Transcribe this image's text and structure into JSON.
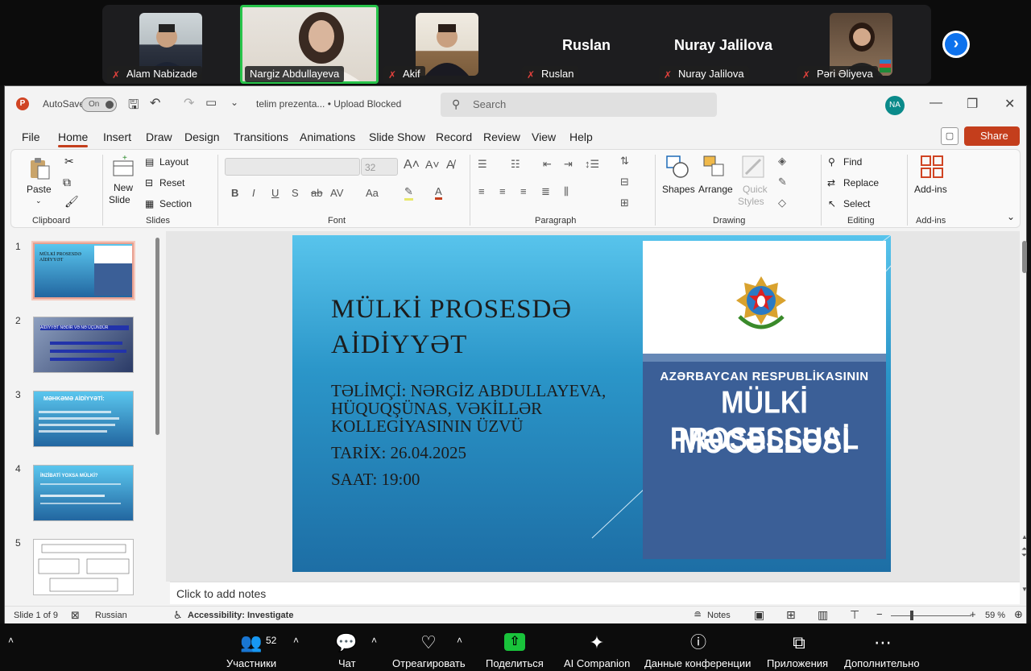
{
  "participants": [
    {
      "name": "Alam Nabizade",
      "muted": true,
      "has_video": true
    },
    {
      "name": "Nargiz Abdullayeva",
      "muted": false,
      "has_video": true,
      "active_speaker": true
    },
    {
      "name": "Akif",
      "muted": true,
      "has_video": true
    },
    {
      "name": "Ruslan",
      "muted": true,
      "has_video": false,
      "display_name": "Ruslan"
    },
    {
      "name": "Nuray Jalilova",
      "muted": true,
      "has_video": false,
      "display_name": "Nuray Jalilova"
    },
    {
      "name": "Pəri Əliyeva",
      "muted": true,
      "has_video": true
    }
  ],
  "ppt": {
    "autosave_label": "AutoSave",
    "autosave_state": "On",
    "filename": "telim prezenta... • Upload Blocked",
    "search_placeholder": "Search",
    "user_initials": "NA",
    "share_label": "Share",
    "menu": [
      "File",
      "Home",
      "Insert",
      "Draw",
      "Design",
      "Transitions",
      "Animations",
      "Slide Show",
      "Record",
      "Review",
      "View",
      "Help"
    ],
    "active_tab": "Home",
    "ribbon": {
      "clipboard": {
        "paste": "Paste",
        "label": "Clipboard"
      },
      "slides": {
        "new_slide_1": "New",
        "new_slide_2": "Slide",
        "layout": "Layout",
        "reset": "Reset",
        "section": "Section",
        "label": "Slides"
      },
      "font": {
        "size": "32",
        "label": "Font"
      },
      "paragraph": {
        "label": "Paragraph"
      },
      "drawing": {
        "shapes": "Shapes",
        "arrange": "Arrange",
        "quick_styles_1": "Quick",
        "quick_styles_2": "Styles",
        "label": "Drawing"
      },
      "editing": {
        "find": "Find",
        "replace": "Replace",
        "select": "Select",
        "label": "Editing"
      },
      "addins": {
        "button": "Add-ins",
        "label": "Add-ins"
      }
    },
    "thumbnails": [
      {
        "num": "1",
        "title": "MÜLKİ PROSESDƏ AİDİYYƏT"
      },
      {
        "num": "2",
        "title": "AİDİYYƏT NƏDİR VƏ NƏ ÜÇÜNDÜR"
      },
      {
        "num": "3",
        "title": "MƏHKƏMƏ AİDİYYƏTİ:"
      },
      {
        "num": "4",
        "title": "İNZİBATİ YOXSA MÜLKİ?"
      },
      {
        "num": "5",
        "title": ""
      }
    ],
    "slide": {
      "title": "MÜLKİ PROSESDƏ AİDİYYƏT",
      "trainer_line1": "TƏLİMÇİ: NƏRGİZ ABDULLAYEVA,",
      "trainer_line2": "HÜQUQŞÜNAS, VƏKİLLƏR",
      "trainer_line3": "KOLLEGİYASININ ÜZVÜ",
      "date": "TARİX: 26.04.2025",
      "time": "SAAT: 19:00",
      "book_subtitle": "AZƏRBAYCAN RESPUBLİKASININ",
      "book_title1": "MÜLKİ PROSESSUAL",
      "book_title2": "MƏCƏLLƏSİ"
    },
    "notes_placeholder": "Click to add notes",
    "status": {
      "slide_info": "Slide 1 of 9",
      "language": "Russian",
      "accessibility": "Accessibility: Investigate",
      "notes": "Notes",
      "zoom": "59 %"
    }
  },
  "zoom_toolbar": {
    "participants_label": "Участники",
    "participants_count": "52",
    "chat_label": "Чат",
    "react_label": "Отреагировать",
    "share_label": "Поделиться",
    "ai_label": "AI Companion",
    "info_label": "Данные конференции",
    "apps_label": "Приложения",
    "more_label": "Дополнительно"
  }
}
